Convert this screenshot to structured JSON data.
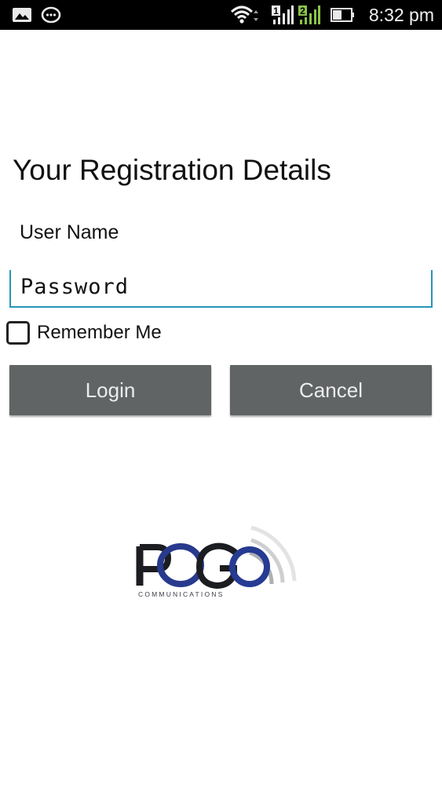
{
  "status_bar": {
    "time": "8:32 pm",
    "icons": [
      "image-icon",
      "chat-icon",
      "wifi-icon",
      "signal-sim1-icon",
      "signal-sim2-icon",
      "battery-icon"
    ],
    "sim1_label": "1",
    "sim2_label": "2"
  },
  "form": {
    "title": "Your Registration Details",
    "username_placeholder": "User Name",
    "password_placeholder": "Password",
    "remember_label": "Remember Me",
    "remember_checked": false,
    "login_label": "Login",
    "cancel_label": "Cancel"
  },
  "logo": {
    "brand_text": "POGO",
    "tagline": "COMMUNICATIONS"
  },
  "colors": {
    "status_bar_bg": "#000000",
    "button_bg": "#616465",
    "input_underline": "#2796b9",
    "sim2_signal": "#8bc34a"
  }
}
